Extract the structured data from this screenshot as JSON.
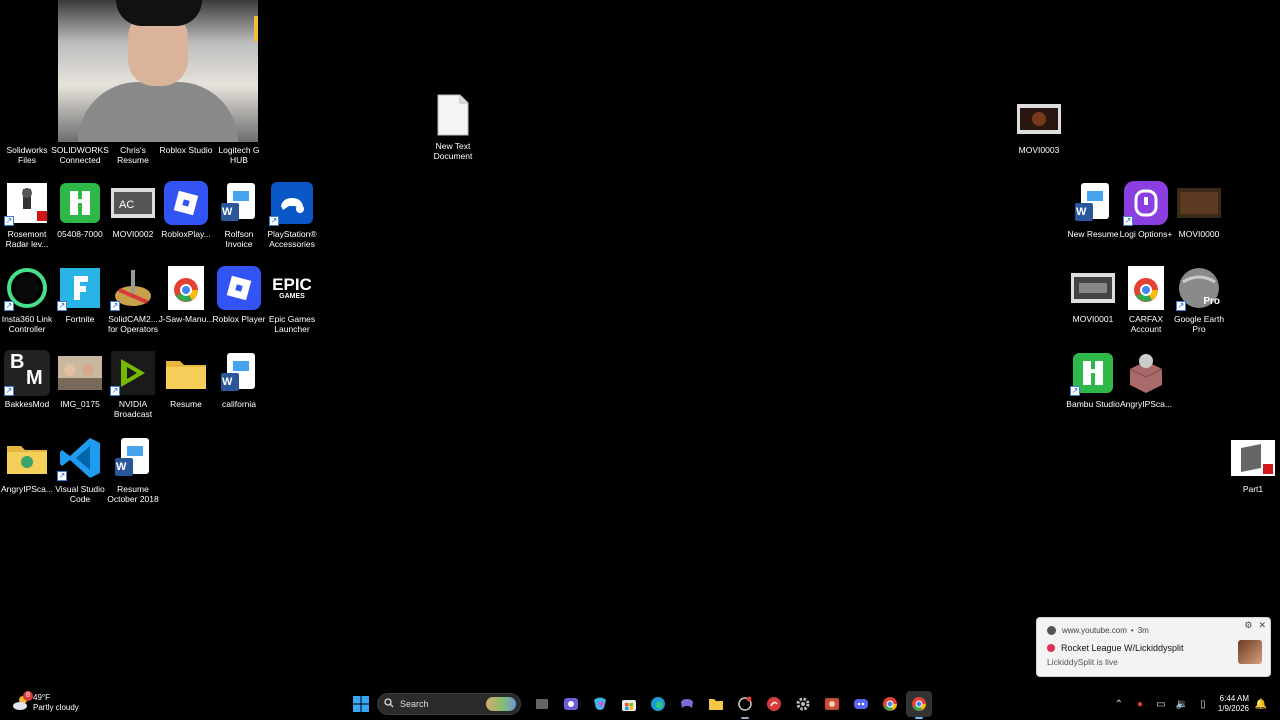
{
  "desktop_icons_left": [
    {
      "name": "solidworks-files",
      "label": "Solidworks Files"
    },
    {
      "name": "solidworks-connected",
      "label": "SOLIDWORKS Connected"
    },
    {
      "name": "chris-resume",
      "label": "Chris's Resume"
    },
    {
      "name": "roblox-studio",
      "label": "Roblox Studio"
    },
    {
      "name": "logitech-g-hub",
      "label": "Logitech G HUB"
    },
    {
      "name": "rosemont-radar",
      "label": "Rosemont Radar lev..."
    },
    {
      "name": "file-05408-7000",
      "label": "05408-7000"
    },
    {
      "name": "movi0002",
      "label": "MOVI0002"
    },
    {
      "name": "robloxplay",
      "label": "RobloxPlay..."
    },
    {
      "name": "rolfson-invoice",
      "label": "Rolfson Invoice"
    },
    {
      "name": "playstation-accessories",
      "label": "PlayStation® Accessories"
    },
    {
      "name": "insta360-link-controller",
      "label": "Insta360 Link Controller"
    },
    {
      "name": "fortnite",
      "label": "Fortnite"
    },
    {
      "name": "solidcam",
      "label": "SolidCAM2... for Operators"
    },
    {
      "name": "j-saw-manu",
      "label": "J-Saw-Manu..."
    },
    {
      "name": "roblox-player",
      "label": "Roblox Player"
    },
    {
      "name": "epic-games-launcher",
      "label": "Epic Games Launcher"
    },
    {
      "name": "bakkesmod",
      "label": "BakkesMod"
    },
    {
      "name": "img-0175",
      "label": "IMG_0175"
    },
    {
      "name": "nvidia-broadcast",
      "label": "NVIDIA Broadcast"
    },
    {
      "name": "resume-folder",
      "label": "Resume"
    },
    {
      "name": "california",
      "label": "california"
    },
    {
      "name": "angryipscan-left",
      "label": "AngryIPSca..."
    },
    {
      "name": "visual-studio-code",
      "label": "Visual Studio Code"
    },
    {
      "name": "resume-october-2018",
      "label": "Resume October 2018"
    }
  ],
  "desktop_icons_right": [
    {
      "name": "new-text-document",
      "label": "New Text Document"
    },
    {
      "name": "movi0003",
      "label": "MOVI0003"
    },
    {
      "name": "new-resume",
      "label": "New Resume"
    },
    {
      "name": "logi-options",
      "label": "Logi Options+"
    },
    {
      "name": "movi0000",
      "label": "MOVI0000"
    },
    {
      "name": "movi0001",
      "label": "MOVI0001"
    },
    {
      "name": "carfax-account",
      "label": "CARFAX Account"
    },
    {
      "name": "google-earth-pro",
      "label": "Google Earth Pro"
    },
    {
      "name": "bambu-studio",
      "label": "Bambu Studio"
    },
    {
      "name": "angryipscan-right",
      "label": "AngryIPSca..."
    },
    {
      "name": "part1",
      "label": "Part1"
    }
  ],
  "icon_glyphs": {
    "epic": "EPIC",
    "epic_sub": "GAMES",
    "bm_b": "B",
    "bm_m": "M",
    "earth_pro": "Pro",
    "word_w": "W"
  },
  "weather": {
    "temp": "49°F",
    "condition": "Partly cloudy",
    "badge": "8"
  },
  "search": {
    "placeholder": "Search"
  },
  "clock": {
    "time": "6:44 AM",
    "date": "1/9/2026"
  },
  "toast": {
    "source": "www.youtube.com",
    "age": "3m",
    "title": "Rocket League W/Lickiddysplit",
    "body": "LickiddySplit is live"
  },
  "colors": {
    "desktop_bg": "#000000",
    "taskbar_bg": "#000000",
    "word_blue": "#2b579a",
    "roblox_blue": "#3354f5",
    "bambu_green": "#2fb84a",
    "toast_bg": "#f3f3f3"
  }
}
